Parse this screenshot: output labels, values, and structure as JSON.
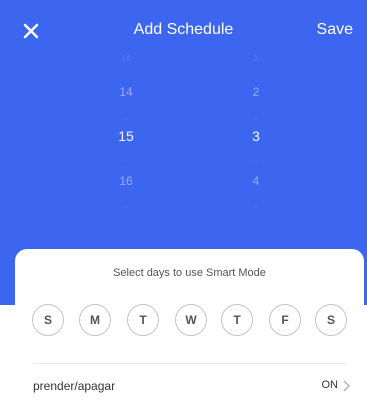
{
  "header": {
    "title": "Add Schedule",
    "save_label": "Save",
    "close_icon": "close-icon"
  },
  "picker": {
    "hours": {
      "above_faint": "14",
      "prev": "14",
      "selected": "15",
      "next": "16"
    },
    "minutes": {
      "above_faint": "1",
      "prev": "2",
      "selected": "3",
      "next": "4"
    }
  },
  "sheet": {
    "caption": "Select days to use Smart Mode",
    "days": [
      "S",
      "M",
      "T",
      "W",
      "T",
      "F",
      "S"
    ],
    "row": {
      "label": "prender/apagar",
      "value": "ON",
      "chevron_icon": "chevron-right-icon"
    }
  },
  "colors": {
    "accent": "#3d66f0",
    "sheet_background": "#ffffff",
    "day_border": "#c4c4c4"
  }
}
